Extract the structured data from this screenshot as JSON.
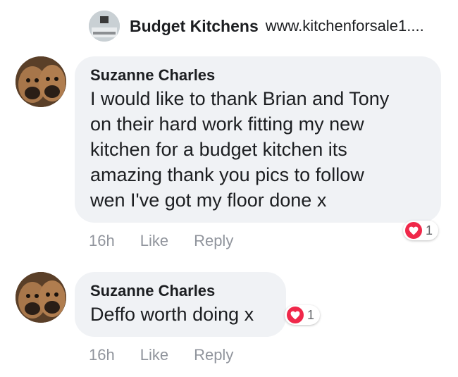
{
  "header": {
    "page_name": "Budget Kitchens",
    "url": "www.kitchenforsale1...."
  },
  "comments": [
    {
      "author": "Suzanne Charles",
      "lines": [
        "I would like to thank Brian and Tony",
        "on their hard work fitting my new",
        "kitchen for a budget kitchen its",
        "amazing thank you pics to follow",
        "wen I've got my floor done x"
      ],
      "time": "16h",
      "like_label": "Like",
      "reply_label": "Reply",
      "reaction": {
        "icon": "heart-icon",
        "count": "1",
        "color": "#f0284a"
      }
    },
    {
      "author": "Suzanne Charles",
      "lines": [
        "Deffo worth doing x"
      ],
      "time": "16h",
      "like_label": "Like",
      "reply_label": "Reply",
      "reaction": {
        "icon": "heart-icon",
        "count": "1",
        "color": "#f0284a"
      }
    }
  ]
}
